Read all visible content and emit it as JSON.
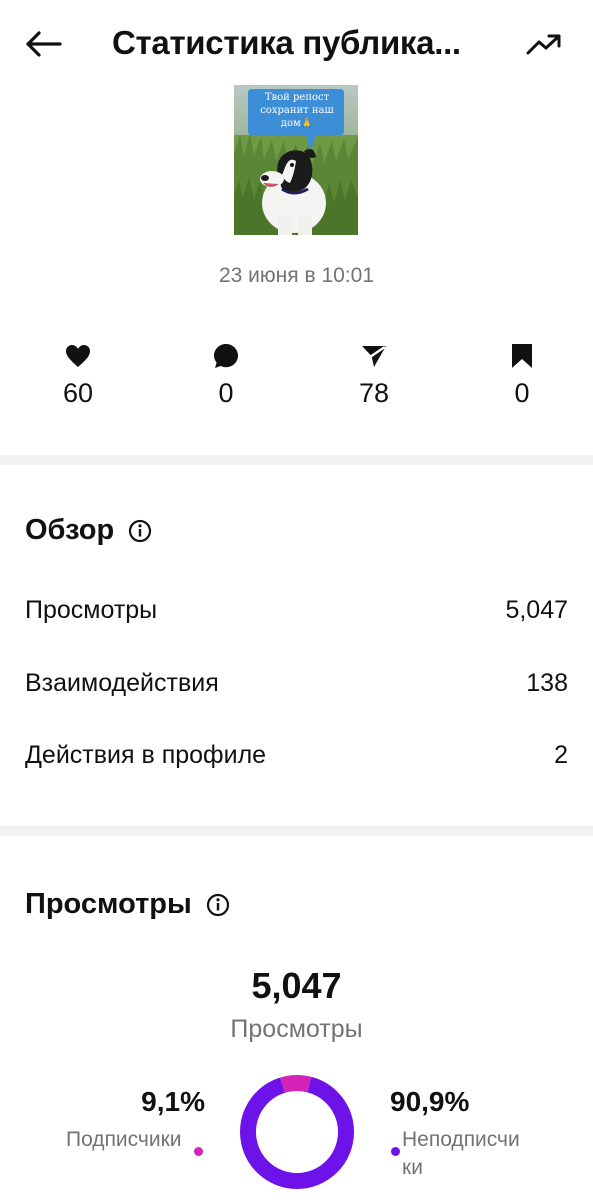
{
  "header": {
    "title": "Статистика публика...",
    "back_icon": "arrow-left-icon",
    "trend_icon": "trending-up-icon"
  },
  "post": {
    "thumbnail_text": "Твой репост сохранит наш дом🙏",
    "date": "23 июня в 10:01"
  },
  "engagement": [
    {
      "icon": "heart-icon",
      "value": "60"
    },
    {
      "icon": "comment-icon",
      "value": "0"
    },
    {
      "icon": "send-icon",
      "value": "78"
    },
    {
      "icon": "bookmark-icon",
      "value": "0"
    }
  ],
  "overview": {
    "title": "Обзор",
    "rows": [
      {
        "label": "Просмотры",
        "value": "5,047"
      },
      {
        "label": "Взаимодействия",
        "value": "138"
      },
      {
        "label": "Действия в профиле",
        "value": "2"
      }
    ]
  },
  "views": {
    "title": "Просмотры",
    "total": "5,047",
    "total_label": "Просмотры",
    "followers": {
      "percent_text": "9,1%",
      "label": "Подписчики",
      "fraction": 0.091,
      "color": "#d323b8"
    },
    "non_followers": {
      "percent_text": "90,9%",
      "label": "Неподписчики",
      "fraction": 0.909,
      "color": "#6d12e8"
    }
  }
}
